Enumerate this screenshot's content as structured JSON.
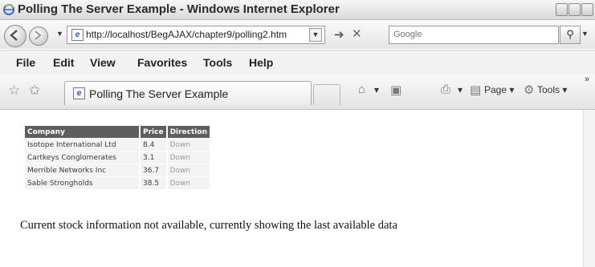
{
  "window": {
    "title": "Polling The Server Example - Windows Internet Explorer"
  },
  "address_bar": {
    "url": "http://localhost/BegAJAX/chapter9/polling2.htm"
  },
  "search": {
    "placeholder": "Google"
  },
  "menu": {
    "items": [
      "File",
      "Edit",
      "View",
      "Favorites",
      "Tools",
      "Help"
    ]
  },
  "tab": {
    "label": "Polling The Server Example"
  },
  "command_bar": {
    "page_label": "Page",
    "tools_label": "Tools"
  },
  "stock_table": {
    "headers": [
      "Company",
      "Price",
      "Direction"
    ],
    "rows": [
      [
        "Isotope International Ltd",
        "8.4",
        "Down"
      ],
      [
        "Cartkeys Conglomerates",
        "3.1",
        "Down"
      ],
      [
        "Merrible Networks Inc",
        "36.7",
        "Down"
      ],
      [
        "Sable Strongholds",
        "38.5",
        "Down"
      ]
    ]
  },
  "status_message": "Current stock information not available, currently showing the last available data"
}
